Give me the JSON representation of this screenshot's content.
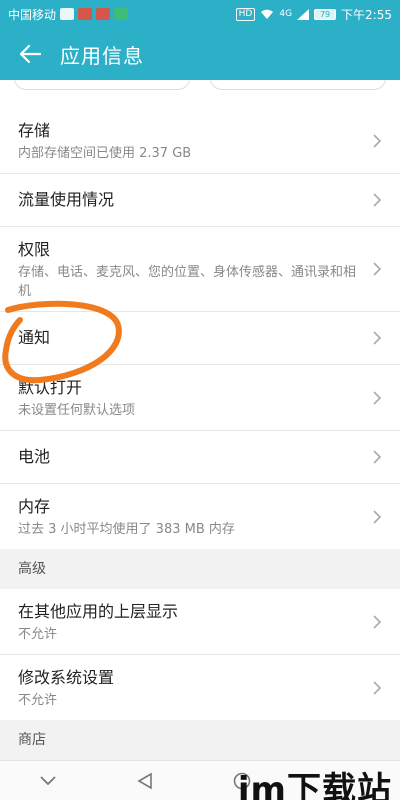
{
  "statusbar": {
    "carrier": "中国移动",
    "hd": "HD",
    "network": "4G",
    "battery": "79",
    "time": "下午2:55"
  },
  "appbar": {
    "title": "应用信息"
  },
  "rows": [
    {
      "title": "存储",
      "subtitle": "内部存储空间已使用 2.37 GB"
    },
    {
      "title": "流量使用情况",
      "subtitle": ""
    },
    {
      "title": "权限",
      "subtitle": "存储、电话、麦克风、您的位置、身体传感器、通讯录和相机"
    },
    {
      "title": "通知",
      "subtitle": ""
    },
    {
      "title": "默认打开",
      "subtitle": "未设置任何默认选项"
    },
    {
      "title": "电池",
      "subtitle": ""
    },
    {
      "title": "内存",
      "subtitle": "过去 3 小时平均使用了 383 MB 内存"
    }
  ],
  "section_advanced": "高级",
  "advanced_rows": [
    {
      "title": "在其他应用的上层显示",
      "subtitle": "不允许"
    },
    {
      "title": "修改系统设置",
      "subtitle": "不允许"
    }
  ],
  "section_store": "商店",
  "watermark": "im下载站",
  "colors": {
    "accent": "#2bb0c8",
    "annotation": "#f07a1e"
  }
}
